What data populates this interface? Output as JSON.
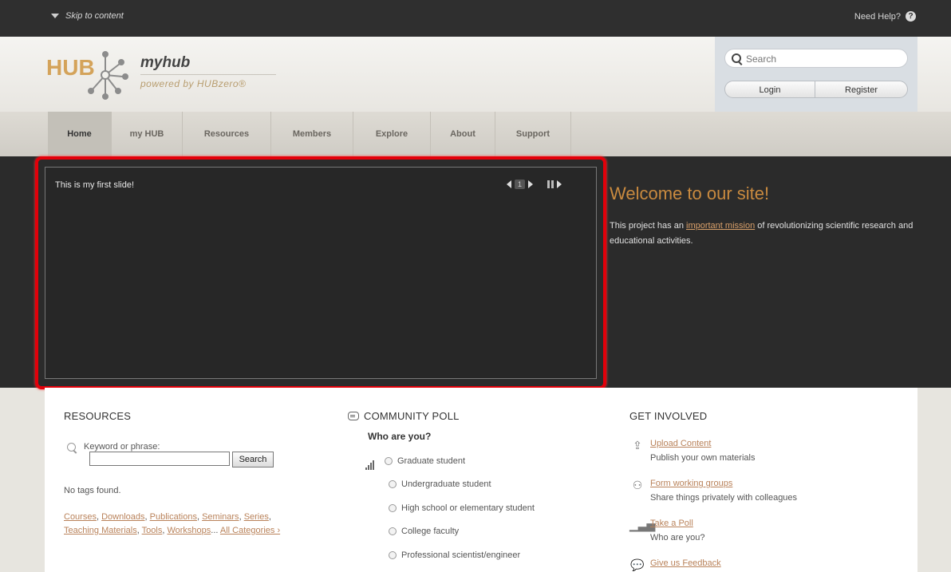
{
  "topbar": {
    "skip_label": "Skip to content",
    "help_label": "Need Help?"
  },
  "brand": {
    "logo_text": "HUB",
    "site_name": "myhub",
    "tagline": "powered by HUBzero®"
  },
  "account": {
    "search_placeholder": "Search",
    "login_label": "Login",
    "register_label": "Register"
  },
  "nav": {
    "items": [
      "Home",
      "my HUB",
      "Resources",
      "Members",
      "Explore",
      "About",
      "Support"
    ],
    "active_index": 0
  },
  "slider": {
    "text": "This is my first slide!",
    "page": "1"
  },
  "welcome": {
    "title": "Welcome to our site!",
    "body_before": "This project has an ",
    "link": "important mission",
    "body_after": " of revolutionizing scientific research and educational activities."
  },
  "resources": {
    "heading": "RESOURCES",
    "keyword_label": "Keyword or phrase:",
    "search_button": "Search",
    "no_tags": "No tags found.",
    "categories": [
      "Courses",
      "Downloads",
      "Publications",
      "Seminars",
      "Series",
      "Teaching Materials",
      "Tools",
      "Workshops"
    ],
    "all_categories": "All Categories ›"
  },
  "poll": {
    "heading": "COMMUNITY POLL",
    "question": "Who are you?",
    "options": [
      "Graduate student",
      "Undergraduate student",
      "High school or elementary student",
      "College faculty",
      "Professional scientist/engineer"
    ]
  },
  "involved": {
    "heading": "GET INVOLVED",
    "items": [
      {
        "link": "Upload Content",
        "desc": "Publish your own materials",
        "icon": "upload-icon"
      },
      {
        "link": "Form working groups",
        "desc": "Share things privately with colleagues",
        "icon": "group-icon"
      },
      {
        "link": "Take a Poll",
        "desc": "Who are you?",
        "icon": "poll-bars-icon"
      },
      {
        "link": "Give us Feedback",
        "desc": "",
        "icon": "speech-bubble-icon"
      }
    ]
  }
}
